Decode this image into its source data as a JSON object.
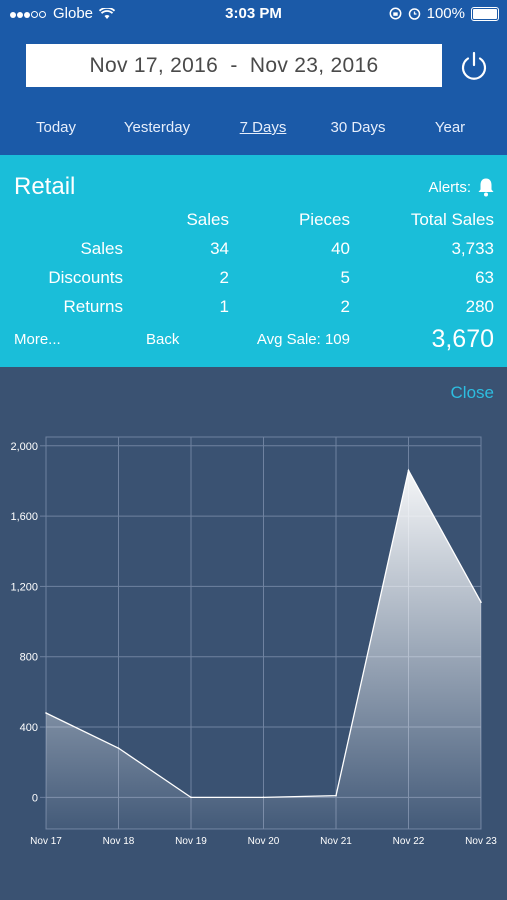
{
  "status_bar": {
    "carrier": "Globe",
    "time": "3:03 PM",
    "battery": "100%"
  },
  "header": {
    "date_range": "Nov 17, 2016  -  Nov 23, 2016",
    "tabs": [
      {
        "label": "Today",
        "active": false
      },
      {
        "label": "Yesterday",
        "active": false
      },
      {
        "label": "7 Days",
        "active": true
      },
      {
        "label": "30 Days",
        "active": false
      },
      {
        "label": "Year",
        "active": false
      }
    ]
  },
  "summary": {
    "title": "Retail",
    "alerts_label": "Alerts:",
    "columns": [
      "Sales",
      "Pieces",
      "Total Sales"
    ],
    "rows": [
      {
        "label": "Sales",
        "values": [
          "34",
          "40",
          "3,733"
        ]
      },
      {
        "label": "Discounts",
        "values": [
          "2",
          "5",
          "63"
        ]
      },
      {
        "label": "Returns",
        "values": [
          "1",
          "2",
          "280"
        ]
      }
    ],
    "more_label": "More...",
    "back_label": "Back",
    "avg_sale": "Avg Sale: 109",
    "net_total": "3,670"
  },
  "chart_panel": {
    "close_label": "Close"
  },
  "colors": {
    "header_bg": "#1b5aa8",
    "panel_bg": "#1abed9",
    "chart_bg": "#3a5272",
    "close_link": "#2dbde0"
  },
  "chart_data": {
    "type": "area",
    "x": [
      "Nov 17",
      "Nov 18",
      "Nov 19",
      "Nov 20",
      "Nov 21",
      "Nov 22",
      "Nov 23"
    ],
    "series": [
      {
        "values": [
          480,
          280,
          0,
          0,
          10,
          1860,
          1110
        ]
      }
    ],
    "y_ticks": [
      "0",
      "400",
      "800",
      "1,200",
      "1,600",
      "2,000"
    ],
    "ylim": [
      -180,
      2050
    ],
    "grid": true
  }
}
